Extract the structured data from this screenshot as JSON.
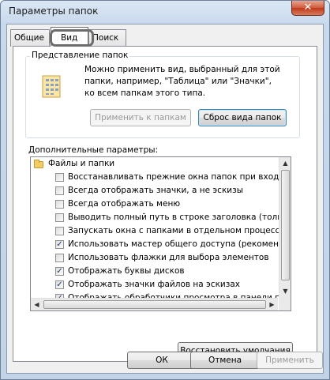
{
  "window": {
    "title": "Параметры папок",
    "close_glyph": "✕"
  },
  "tabs": [
    {
      "label": "Общие"
    },
    {
      "label": "Вид"
    },
    {
      "label": "Поиск"
    }
  ],
  "folder_views": {
    "label": "Представление папок",
    "description": "Можно применить вид, выбранный для этой папки, например, \"Таблица\" или \"Значки\", ко всем папкам этого типа.",
    "apply_button": "Применить к папкам",
    "reset_button": "Сброс вида папок"
  },
  "advanced": {
    "label": "Дополнительные параметры:",
    "category": "Файлы и папки",
    "items": [
      {
        "text": "Восстанавливать прежние окна папок при входе в си",
        "checked": false
      },
      {
        "text": "Всегда отображать значки, а не эскизы",
        "checked": false
      },
      {
        "text": "Всегда отображать меню",
        "checked": false
      },
      {
        "text": "Выводить полный путь в строке заголовка (только д",
        "checked": false
      },
      {
        "text": "Запускать окна с папками в отдельном процессе",
        "checked": false
      },
      {
        "text": "Использовать мастер общего доступа (рекомендует",
        "checked": true
      },
      {
        "text": "Использовать флажки для выбора элементов",
        "checked": false
      },
      {
        "text": "Отображать буквы дисков",
        "checked": true
      },
      {
        "text": "Отображать значки файлов на эскизах",
        "checked": true
      },
      {
        "text": "Отображать обработчики просмотра в панели просм",
        "checked": true
      }
    ],
    "restore_button": "Восстановить умолчания"
  },
  "footer": {
    "ok": "ОК",
    "cancel": "Отмена",
    "apply": "Применить"
  },
  "colors": {
    "accent": "#3c7fb1",
    "titlebar": "#c9d9ec",
    "close": "#c2391b"
  }
}
